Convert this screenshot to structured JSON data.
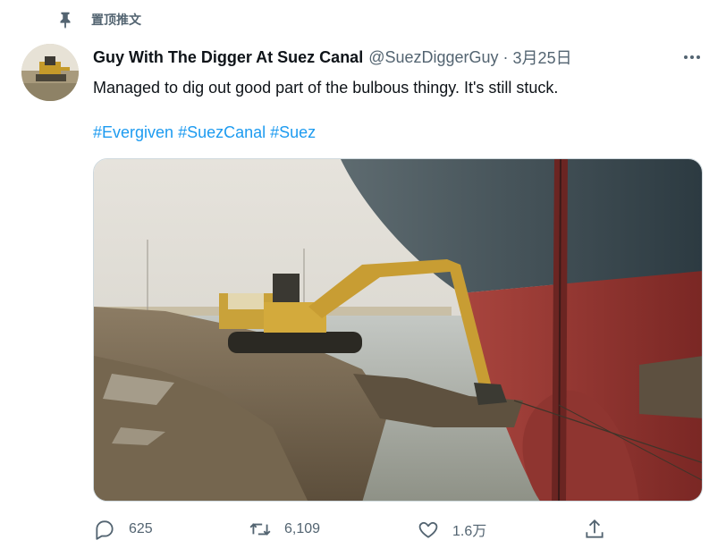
{
  "pinned": {
    "label": "置顶推文",
    "icon": "pin-icon"
  },
  "author": {
    "name": "Guy With The Digger At Suez Canal",
    "handle": "@SuezDiggerGuy",
    "separator": "·",
    "time": "3月25日",
    "avatar": "avatar-excavator"
  },
  "tweet": {
    "text": "Managed to dig out good part of the bulbous thingy. It's still stuck.",
    "hashtags": [
      "#Evergiven",
      "#SuezCanal",
      "#Suez"
    ],
    "media": "photo-excavator-digging-near-ship-bow"
  },
  "actions": {
    "reply_count": "625",
    "retweet_count": "6,109",
    "like_count": "1.6万"
  },
  "colors": {
    "link": "#1d9bf0",
    "muted": "#536471",
    "text": "#0f1419"
  }
}
